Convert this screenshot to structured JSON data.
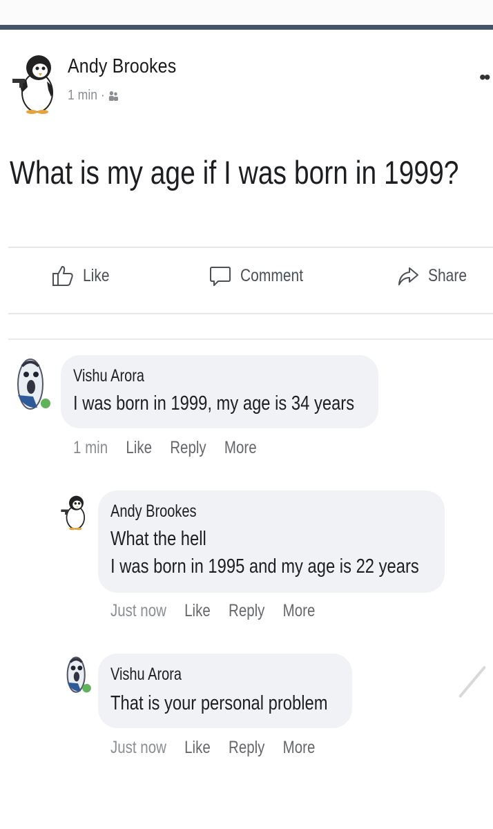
{
  "post": {
    "author": "Andy Brookes",
    "time": "1 min ·",
    "text": "What is my age if I was born in 1999?"
  },
  "actions": {
    "like": "Like",
    "comment": "Comment",
    "share": "Share"
  },
  "comments": [
    {
      "author": "Vishu Arora",
      "lines": [
        "I was born in 1999, my age is 34 years"
      ],
      "time": "1 min",
      "like": "Like",
      "reply": "Reply",
      "more": "More",
      "online": true
    },
    {
      "author": "Andy Brookes",
      "lines": [
        "What the hell",
        "I was born in 1995 and my age is 22 years"
      ],
      "time": "Just now",
      "like": "Like",
      "reply": "Reply",
      "more": "More"
    },
    {
      "author": "Vishu Arora",
      "lines": [
        "That is your personal problem"
      ],
      "time": "Just now",
      "like": "Like",
      "reply": "Reply",
      "more": "More",
      "online": true
    }
  ],
  "colors": {
    "header_bar": "#44536a",
    "bubble": "#f0f2f5",
    "online_dot": "#5fb35a",
    "muted_text": "#65676b"
  },
  "icons": {
    "post_avatar": "penguin-with-gun-icon",
    "comment_avatar": "scared-face-icon",
    "privacy": "friends-icon",
    "like": "thumbs-up-icon",
    "comment": "speech-bubble-icon",
    "share": "share-arrow-icon"
  }
}
